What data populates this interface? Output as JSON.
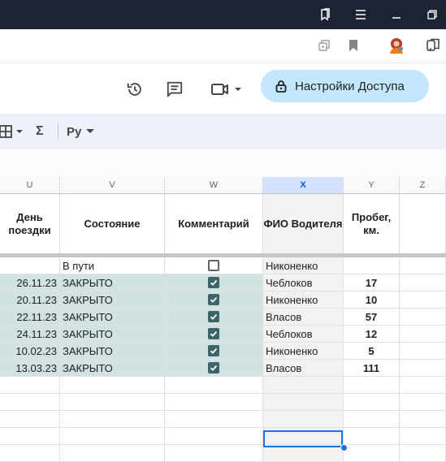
{
  "window": {
    "icons": [
      "bookmark-icon",
      "menu-icon",
      "minimize-icon",
      "restore-icon"
    ]
  },
  "browser": {
    "icons": [
      "extension-icon",
      "bookmark-icon",
      "profile-avatar-icon",
      "collections-icon"
    ]
  },
  "header": {
    "share_label": "Настройки Доступа"
  },
  "toolbar": {
    "sigma": "Σ",
    "format_label": "Ру"
  },
  "columns": [
    {
      "letter": "U",
      "header": "День поездки"
    },
    {
      "letter": "V",
      "header": "Состояние"
    },
    {
      "letter": "W",
      "header": "Комментарий"
    },
    {
      "letter": "X",
      "header": "ФИО Водителя"
    },
    {
      "letter": "Y",
      "header": "Пробег, км."
    },
    {
      "letter": "Z",
      "header": ""
    }
  ],
  "rows": [
    {
      "date": "",
      "status": "В пути",
      "checked": false,
      "driver": "Никоненко",
      "km": "",
      "done": false
    },
    {
      "date": "26.11.23",
      "status": "ЗАКРЫТО",
      "checked": true,
      "driver": "Чеблоков",
      "km": "17",
      "done": true
    },
    {
      "date": "20.11.23",
      "status": "ЗАКРЫТО",
      "checked": true,
      "driver": "Никоненко",
      "km": "10",
      "done": true
    },
    {
      "date": "22.11.23",
      "status": "ЗАКРЫТО",
      "checked": true,
      "driver": "Власов",
      "km": "57",
      "done": true
    },
    {
      "date": "24.11.23",
      "status": "ЗАКРЫТО",
      "checked": true,
      "driver": "Чеблоков",
      "km": "12",
      "done": true
    },
    {
      "date": "10.02.23",
      "status": "ЗАКРЫТО",
      "checked": true,
      "driver": "Никоненко",
      "km": "5",
      "done": true
    },
    {
      "date": "13.03.23",
      "status": "ЗАКРЫТО",
      "checked": true,
      "driver": "Власов",
      "km": "111",
      "done": true
    }
  ],
  "empty_rows": 5,
  "colors": {
    "accent": "#1a73e8",
    "done_fill": "#d1e2e3",
    "checkbox": "#3d6469",
    "share_bg": "#c2e7ff"
  }
}
